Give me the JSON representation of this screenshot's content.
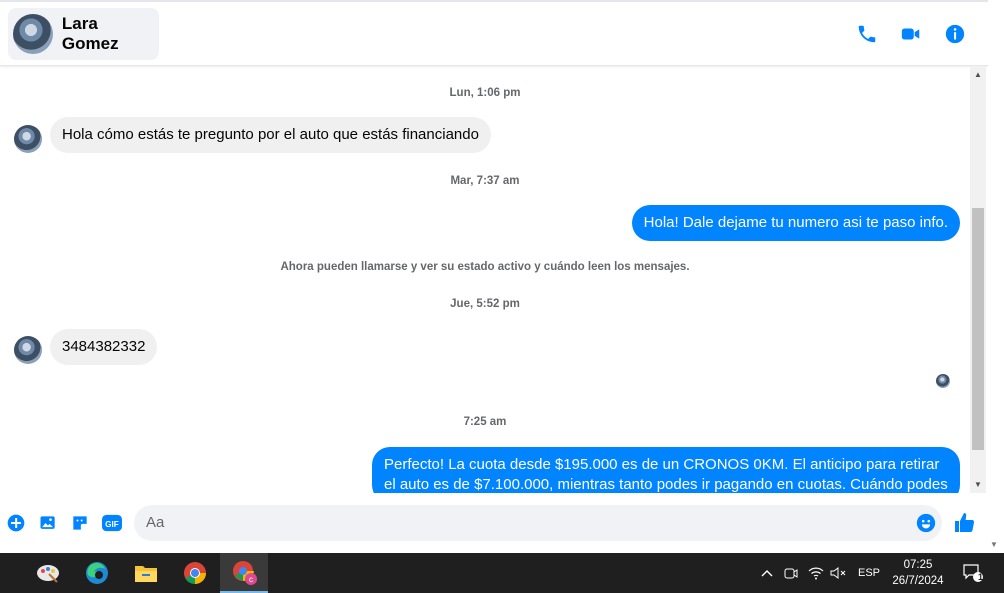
{
  "header": {
    "contact_name": "Lara Gomez",
    "icons": [
      "phone-icon",
      "video-camera-icon",
      "info-icon"
    ],
    "accent_color": "#0084ff"
  },
  "thread": {
    "timestamps": [
      "Lun, 1:06 pm",
      "Mar, 7:37 am",
      "Jue, 5:52 pm",
      "7:25 am"
    ],
    "notice": "Ahora pueden llamarse y ver su estado activo y cuándo leen los mensajes.",
    "messages": [
      {
        "from": "Lara Gomez",
        "text": "Hola cómo estás te pregunto por el auto que estás financiando"
      },
      {
        "from": "me",
        "text": "Hola! Dale dejame tu numero  asi te paso info."
      },
      {
        "from": "Lara Gomez",
        "text": "3484382332"
      },
      {
        "from": "me",
        "text": "Perfecto! La cuota desde $195.000 es de un CRONOS 0KM. El anticipo para retirar el auto es de $7.100.000, mientras tanto podes ir pagando en cuotas. Cuándo podes"
      }
    ]
  },
  "composer": {
    "placeholder": "Aa",
    "icons": [
      "add-circle-icon",
      "image-icon",
      "sticker-icon",
      "gif-icon",
      "emoji-icon",
      "thumbs-up-icon"
    ]
  },
  "taskbar": {
    "apps": [
      "paint-app-icon",
      "edge-icon",
      "file-explorer-icon",
      "chrome-icon",
      "chrome-profile-icon"
    ],
    "tray": {
      "language": "ESP",
      "time": "07:25",
      "date": "26/7/2024",
      "notifications": "1"
    }
  }
}
